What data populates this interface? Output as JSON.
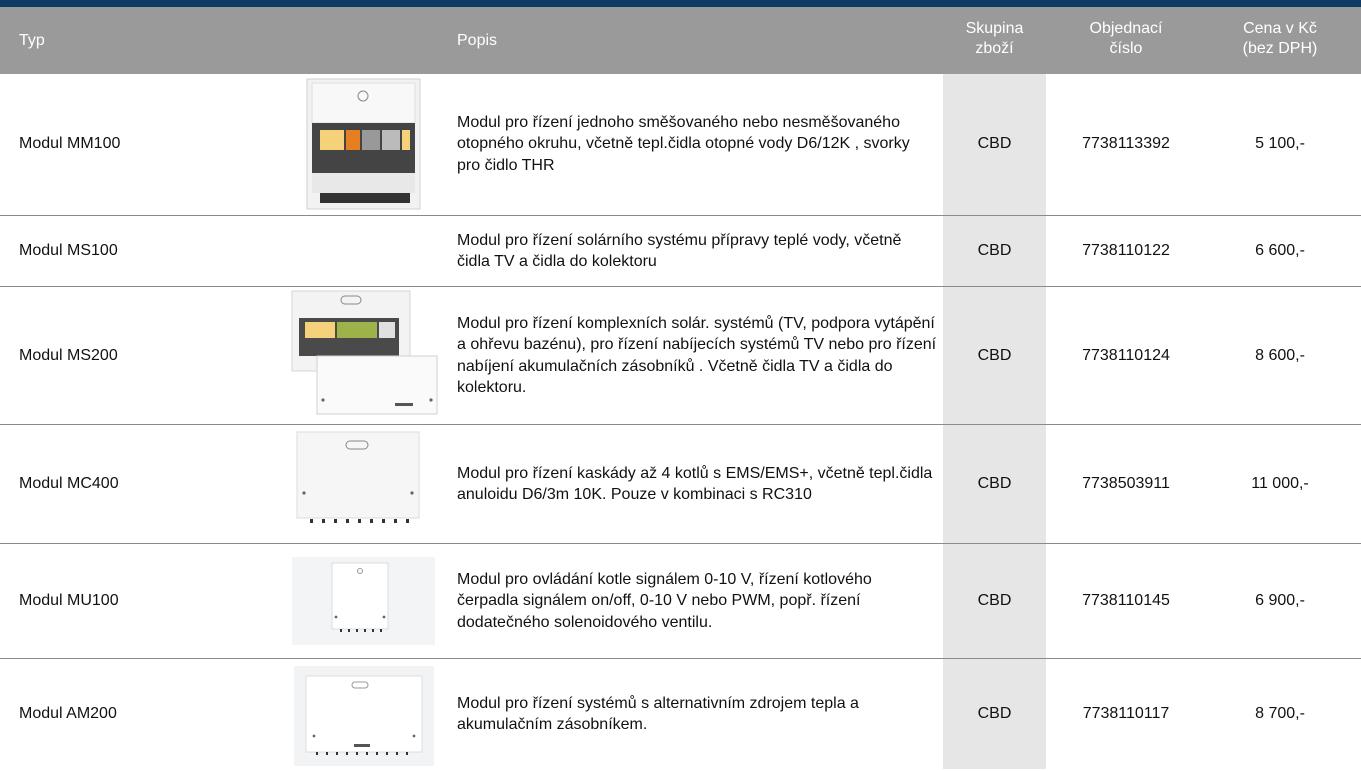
{
  "header": {
    "typ": "Typ",
    "popis": "Popis",
    "skupina_l1": "Skupina",
    "skupina_l2": "zboží",
    "objednaci_l1": "Objednací",
    "objednaci_l2": "číslo",
    "cena_l1": "Cena v Kč",
    "cena_l2": "(bez DPH)"
  },
  "rows": [
    {
      "typ": "Modul MM100",
      "popis": "Modul pro řízení jednoho směšovaného nebo nesměšovaného otopného okruhu, včetně tepl.čidla otopné vody D6/12K , svorky pro čidlo THR",
      "skupina": "CBD",
      "objednaci": "7738113392",
      "cena": "5 100,-",
      "image": "module-mm100-image"
    },
    {
      "typ": "Modul MS100",
      "popis": "Modul pro řízení solárního systému přípravy teplé vody, včetně čidla TV a čidla do kolektoru",
      "skupina": "CBD",
      "objednaci": "7738110122",
      "cena": "6 600,-",
      "image": ""
    },
    {
      "typ": "Modul MS200",
      "popis": "Modul pro řízení komplexních solár. systémů (TV, podpora vytápění a ohřevu bazénu), pro řízení nabíjecích systémů TV nebo pro řízení nabíjení akumulačních zásobníků . Včetně čidla TV a čidla do kolektoru.",
      "skupina": "CBD",
      "objednaci": "7738110124",
      "cena": "8 600,-",
      "image": "module-ms200-image"
    },
    {
      "typ": "Modul MC400",
      "popis": "Modul pro řízení kaskády až 4 kotlů s EMS/EMS+, včetně tepl.čidla anuloidu D6/3m 10K. Pouze v kombinaci s RC310",
      "skupina": "CBD",
      "objednaci": "7738503911",
      "cena": "11 000,-",
      "image": "module-mc400-image"
    },
    {
      "typ": "Modul MU100",
      "popis": "Modul pro ovládání kotle signálem 0-10 V, řízení kotlového čerpadla signálem on/off, 0-10 V nebo PWM, popř. řízení dodatečného solenoidového ventilu.",
      "skupina": "CBD",
      "objednaci": "7738110145",
      "cena": "6 900,-",
      "image": "module-mu100-image"
    },
    {
      "typ": "Modul AM200",
      "popis": "Modul pro řízení systémů s alternativním zdrojem tepla a akumulačním zásobníkem.",
      "skupina": "CBD",
      "objednaci": "7738110117",
      "cena": "8 700,-",
      "image": "module-am200-image"
    }
  ],
  "brand_colors": {
    "top_bar": "#0f3a63",
    "header_bg": "#9a9a9a",
    "highlight_col": "#e6e6e6"
  }
}
